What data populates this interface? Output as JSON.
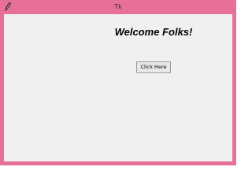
{
  "window": {
    "title": "Tk",
    "accent_color": "#e96f9b",
    "icon": "feather-icon"
  },
  "main": {
    "heading": "Welcome Folks!",
    "button_label": "Click Here"
  }
}
